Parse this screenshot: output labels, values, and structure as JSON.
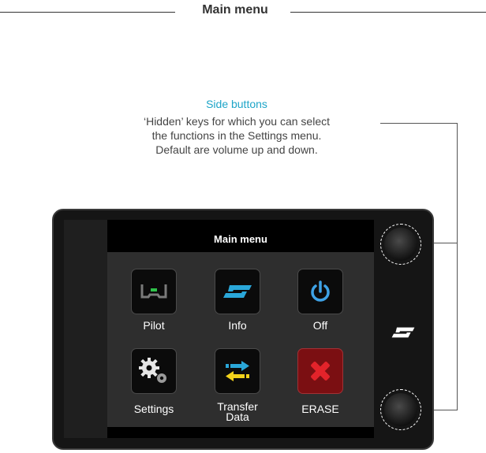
{
  "heading": "Main menu",
  "annotation": {
    "title": "Side buttons",
    "lines": [
      "‘Hidden’ keys for which you can select",
      "the functions in the Settings menu.",
      "Default are volume up and down."
    ]
  },
  "screen": {
    "title": "Main menu",
    "items": [
      {
        "label": "Pilot"
      },
      {
        "label": "Info"
      },
      {
        "label": "Off"
      },
      {
        "label": "Settings"
      },
      {
        "label": "Transfer\nData"
      },
      {
        "label": "ERASE"
      }
    ]
  },
  "colors": {
    "accent": "#1ea5c8",
    "logo_blue": "#2aa7d9",
    "power_blue": "#3ea2e6",
    "erase_red": "#e3232a"
  },
  "icons": [
    "pilot-icon",
    "info-logo-icon",
    "power-icon",
    "settings-gears-icon",
    "transfer-arrows-icon",
    "erase-x-icon",
    "brand-logo-icon"
  ]
}
